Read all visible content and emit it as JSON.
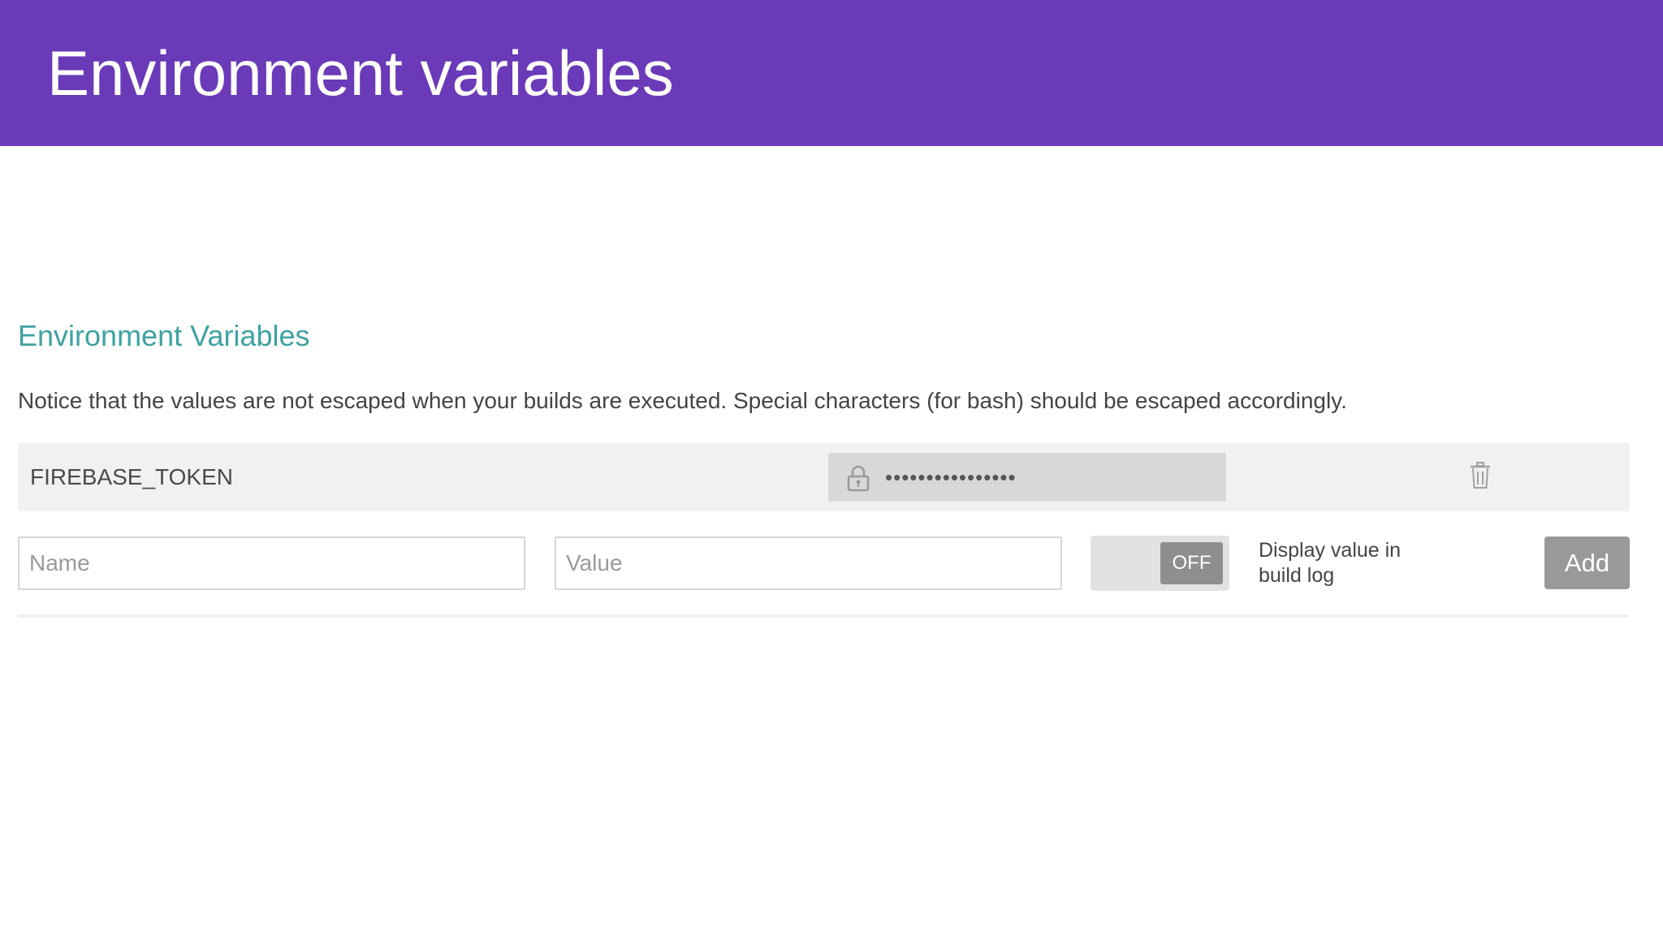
{
  "header": {
    "title": "Environment variables",
    "background_color": "#6a3ab8"
  },
  "section": {
    "heading": "Environment Variables",
    "heading_color": "#3ea2a0",
    "notice": "Notice that the values are not escaped when your builds are executed. Special characters (for bash) should be escaped accordingly."
  },
  "variables": [
    {
      "name": "FIREBASE_TOKEN",
      "masked_value": "••••••••••••••••",
      "icon": "lock-icon",
      "delete_icon": "trash-icon"
    }
  ],
  "form": {
    "name_placeholder": "Name",
    "value_placeholder": "Value",
    "toggle_state": "OFF",
    "toggle_label": "Display value in build log",
    "add_label": "Add"
  }
}
